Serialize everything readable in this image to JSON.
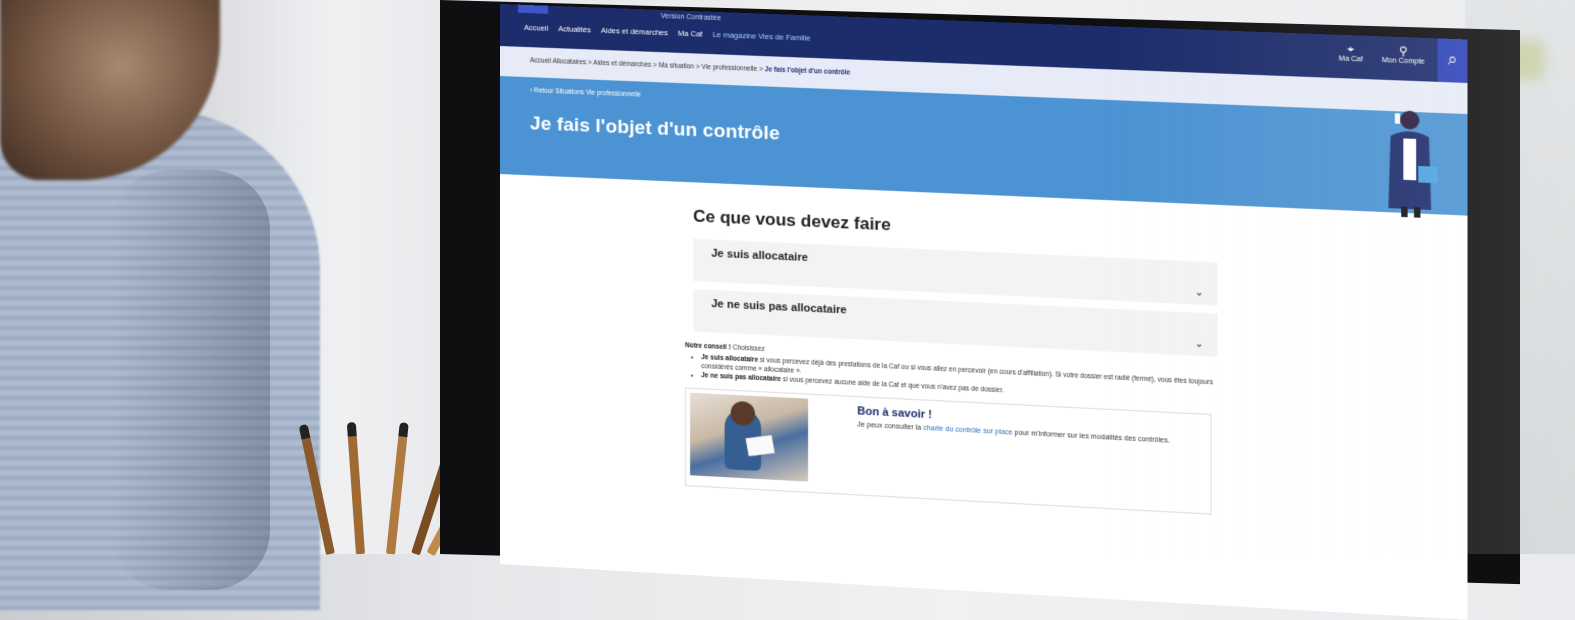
{
  "site": {
    "version_label": "Version Contrastée",
    "menu": [
      "Accueil",
      "Actualités",
      "Aides et démarches",
      "Ma Caf",
      "Le magazine Vies de Famille"
    ],
    "account_items": [
      "Ma Caf",
      "Mon Compte"
    ],
    "breadcrumb_links": "Accueil Allocataires > Aides et démarches > Ma situation > Vie professionnelle > ",
    "breadcrumb_current": "Je fais l'objet d'un contrôle",
    "back_link": "Retour Situations Vie professionnelle",
    "page_title": "Je fais l'objet d'un contrôle"
  },
  "content": {
    "section_title": "Ce que vous devez faire",
    "accordions": [
      "Je suis allocataire",
      "Je ne suis pas allocataire"
    ],
    "advice_label": "Notre conseil !",
    "advice_hint": "Choisissez",
    "bullet1_strong": "Je suis allocataire",
    "bullet1_text": " si vous percevez déjà des prestations de la Caf ou si vous allez en percevoir (en cours d'affiliation). Si votre dossier est radié (fermé), vous êtes toujours considérés comme « allocataire ».",
    "bullet2_strong": "Je ne suis pas allocataire",
    "bullet2_text": " si vous percevez aucune aide de la Caf et que vous n'avez pas de dossier.",
    "bon_title": "Bon à savoir !",
    "bon_text_before": "Je peux consulter la ",
    "bon_link": "charte du contrôle sur place",
    "bon_text_after": " pour m'informer sur les modalités des contrôles."
  },
  "colors": {
    "nav": "#1d2c6b",
    "hero": "#4b93d2",
    "accent": "#2d43b8"
  }
}
